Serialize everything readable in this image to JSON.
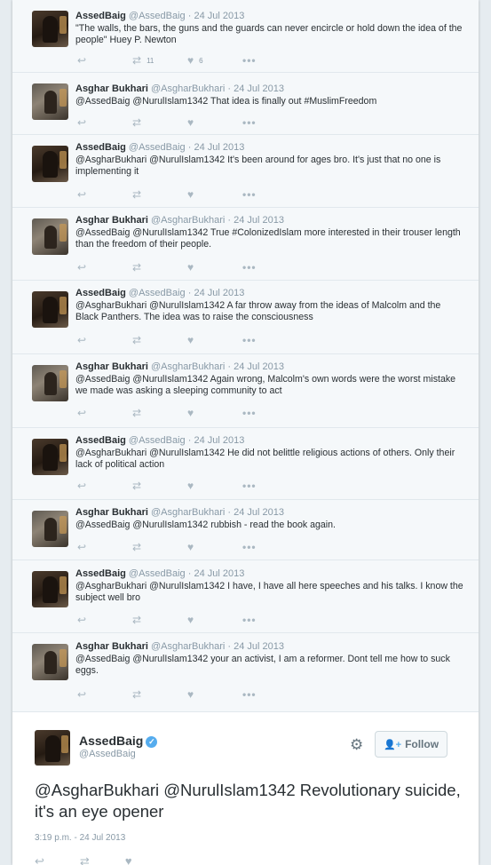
{
  "replies": [
    {
      "name": "AssedBaig",
      "handle": "@AssedBaig",
      "date": "24 Jul 2013",
      "text": "\"The walls, the bars, the guns and the guards can never encircle or hold down the idea of the people\" Huey P. Newton",
      "retweets": "11",
      "likes": "6",
      "author": "assed"
    },
    {
      "name": "Asghar Bukhari",
      "handle": "@AsgharBukhari",
      "date": "24 Jul 2013",
      "text": "@AssedBaig @NurulIslam1342 That idea is finally out #MuslimFreedom",
      "retweets": "",
      "likes": "",
      "author": "asghar"
    },
    {
      "name": "AssedBaig",
      "handle": "@AssedBaig",
      "date": "24 Jul 2013",
      "text": "@AsgharBukhari @NurulIslam1342 It's been around for ages bro.  It's just that no one is implementing it",
      "retweets": "",
      "likes": "",
      "author": "assed"
    },
    {
      "name": "Asghar Bukhari",
      "handle": "@AsgharBukhari",
      "date": "24 Jul 2013",
      "text": "@AssedBaig @NurulIslam1342 True #ColonizedIslam more interested in their trouser length than the freedom of their people.",
      "retweets": "",
      "likes": "",
      "author": "asghar"
    },
    {
      "name": "AssedBaig",
      "handle": "@AssedBaig",
      "date": "24 Jul 2013",
      "text": "@AsgharBukhari @NurulIslam1342 A far throw away from the ideas of Malcolm and the Black Panthers. The idea was to raise the consciousness",
      "retweets": "",
      "likes": "",
      "author": "assed"
    },
    {
      "name": "Asghar Bukhari",
      "handle": "@AsgharBukhari",
      "date": "24 Jul 2013",
      "text": "@AssedBaig @NurulIslam1342 Again wrong, Malcolm's own words were the worst mistake we made was asking a sleeping community to act",
      "retweets": "",
      "likes": "",
      "author": "asghar"
    },
    {
      "name": "AssedBaig",
      "handle": "@AssedBaig",
      "date": "24 Jul 2013",
      "text": "@AsgharBukhari @NurulIslam1342 He did not belittle religious actions of others. Only their lack of political action",
      "retweets": "",
      "likes": "",
      "author": "assed"
    },
    {
      "name": "Asghar Bukhari",
      "handle": "@AsgharBukhari",
      "date": "24 Jul 2013",
      "text": "@AssedBaig @NurulIslam1342 rubbish - read the book again.",
      "retweets": "",
      "likes": "",
      "author": "asghar"
    },
    {
      "name": "AssedBaig",
      "handle": "@AssedBaig",
      "date": "24 Jul 2013",
      "text": "@AsgharBukhari @NurulIslam1342 I have, I have all here speeches and his talks.  I know the subject well bro",
      "retweets": "",
      "likes": "",
      "author": "assed"
    },
    {
      "name": "Asghar Bukhari",
      "handle": "@AsgharBukhari",
      "date": "24 Jul 2013",
      "text": "@AssedBaig @NurulIslam1342 your an activist, I am a reformer. Dont tell me how to suck eggs.",
      "retweets": "",
      "likes": "",
      "author": "asghar"
    }
  ],
  "main_tweet": {
    "name": "AssedBaig",
    "handle": "@AssedBaig",
    "follow_label": "Follow",
    "text": "@AsgharBukhari @NurulIslam1342 Revolutionary suicide, it's an eye opener",
    "timestamp": "3:19 p.m. - 24 Jul 2013"
  },
  "icons": {
    "reply": "reply-icon",
    "retweet": "retweet-icon",
    "like": "heart-icon",
    "more": "more-icon",
    "gear": "gear-icon",
    "verified": "verified-badge-icon",
    "follow": "add-person-icon"
  },
  "colors": {
    "background": "#e6ecf0",
    "reply_bg": "#f5f8fa",
    "muted_text": "#8899a6",
    "accent": "#55acee"
  }
}
